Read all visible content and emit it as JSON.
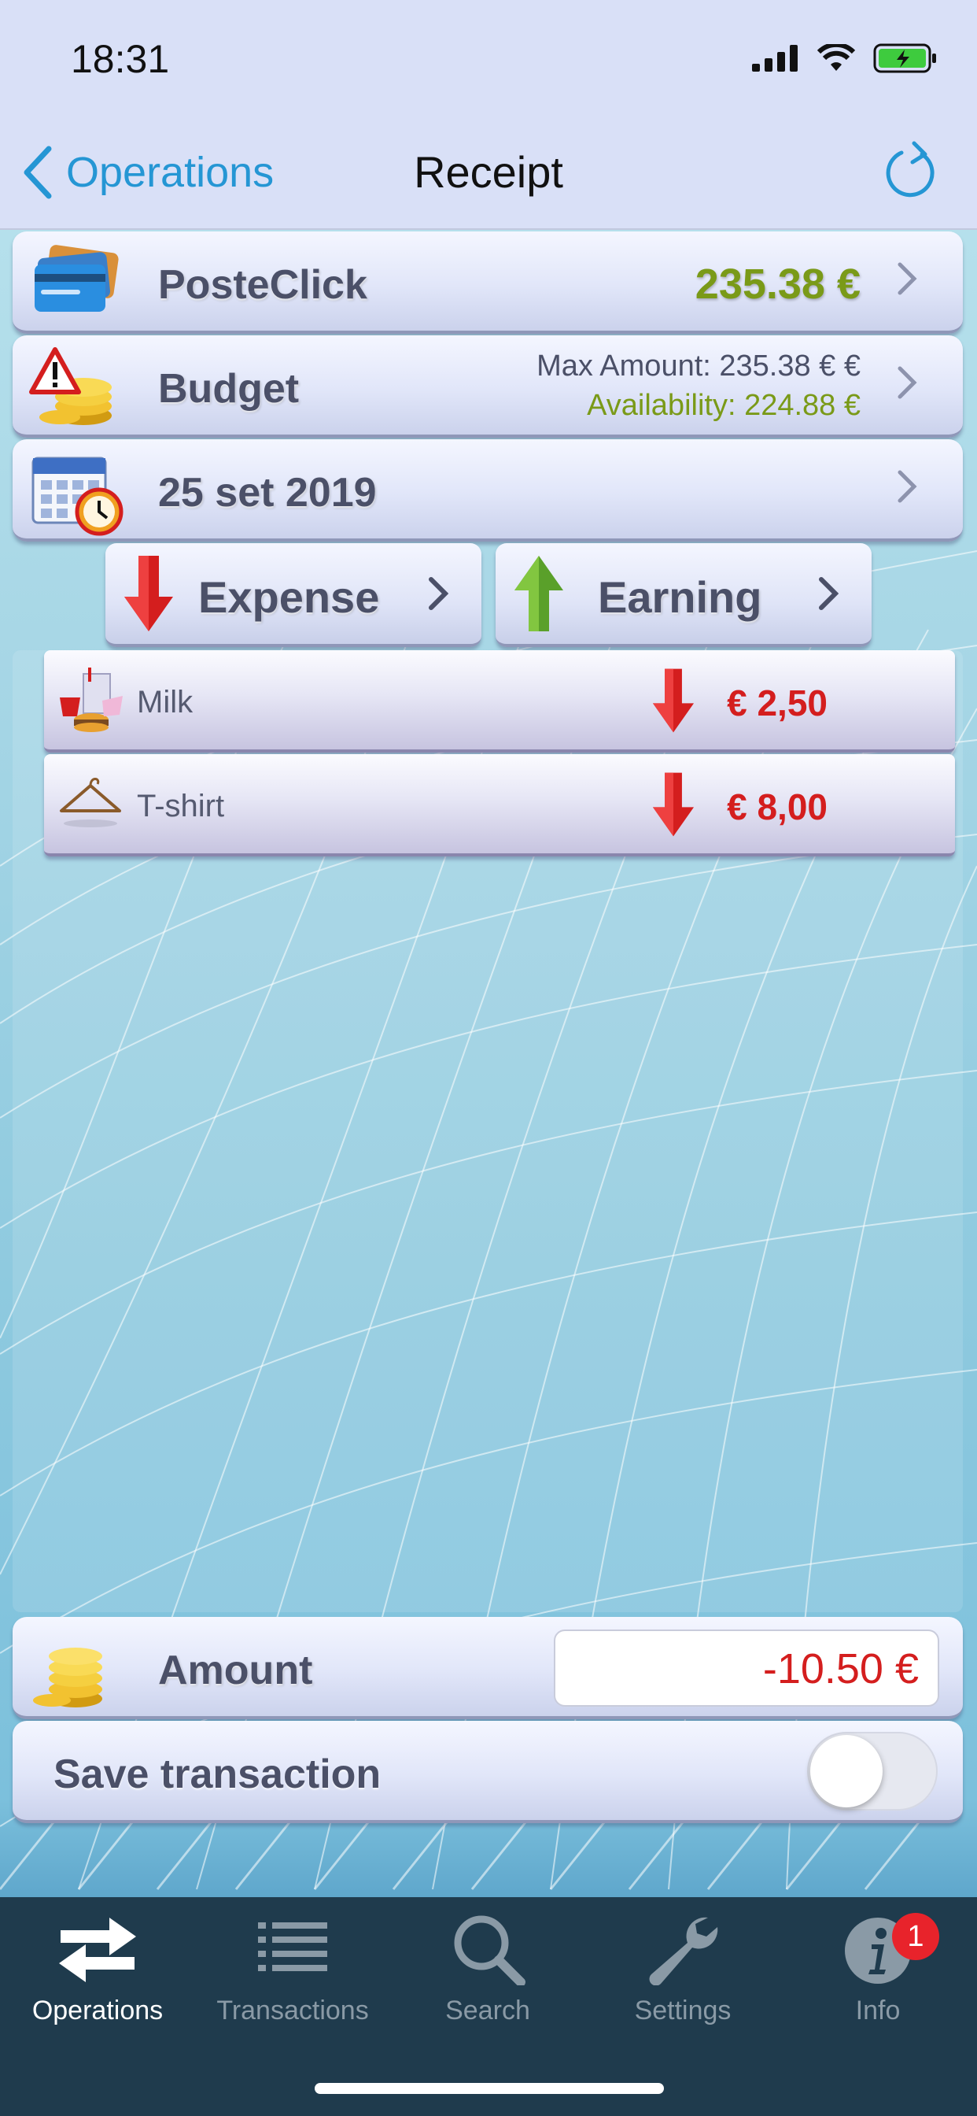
{
  "status": {
    "time": "18:31"
  },
  "nav": {
    "back_label": "Operations",
    "title": "Receipt"
  },
  "account": {
    "name": "PosteClick",
    "amount": "235.38 €"
  },
  "budget": {
    "label": "Budget",
    "max_amount": "Max Amount: 235.38 € €",
    "availability": "Availability: 224.88 €"
  },
  "date": {
    "value": "25 set 2019"
  },
  "type_buttons": {
    "expense": "Expense",
    "earning": "Earning"
  },
  "items": [
    {
      "name": "Milk",
      "amount": "€ 2,50"
    },
    {
      "name": "T-shirt",
      "amount": "€ 8,00"
    }
  ],
  "amount": {
    "label": "Amount",
    "value": "-10.50 €"
  },
  "save": {
    "label": "Save transaction",
    "enabled": false
  },
  "tabs": [
    {
      "label": "Operations",
      "icon": "arrows-swap-icon",
      "active": true
    },
    {
      "label": "Transactions",
      "icon": "list-icon"
    },
    {
      "label": "Search",
      "icon": "search-icon"
    },
    {
      "label": "Settings",
      "icon": "wrench-icon"
    },
    {
      "label": "Info",
      "icon": "info-icon",
      "badge": "1"
    }
  ],
  "colors": {
    "accent": "#2596d4",
    "positive": "#7a9a18",
    "negative": "#d41e1e",
    "tabbar": "#1f3b4d"
  }
}
